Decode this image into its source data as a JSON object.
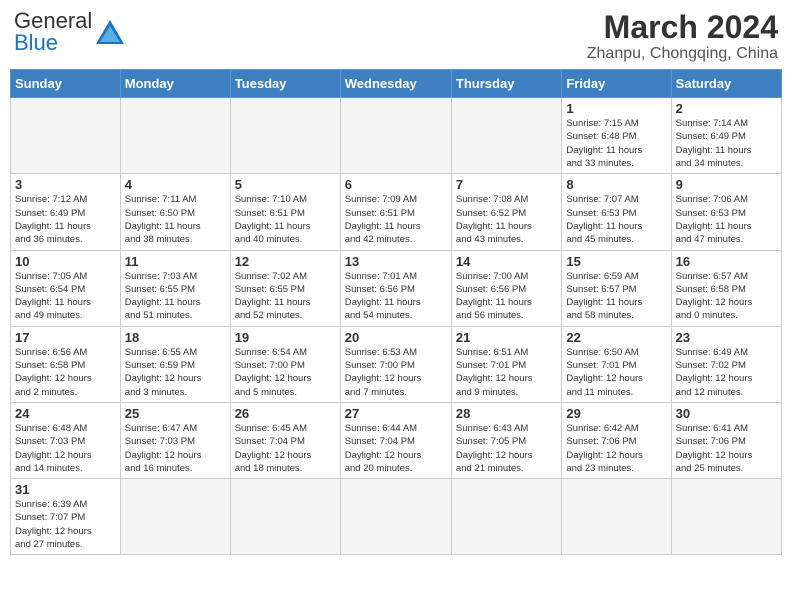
{
  "header": {
    "logo_general": "General",
    "logo_blue": "Blue",
    "month_year": "March 2024",
    "location": "Zhanpu, Chongqing, China"
  },
  "weekdays": [
    "Sunday",
    "Monday",
    "Tuesday",
    "Wednesday",
    "Thursday",
    "Friday",
    "Saturday"
  ],
  "weeks": [
    [
      {
        "day": "",
        "info": ""
      },
      {
        "day": "",
        "info": ""
      },
      {
        "day": "",
        "info": ""
      },
      {
        "day": "",
        "info": ""
      },
      {
        "day": "",
        "info": ""
      },
      {
        "day": "1",
        "info": "Sunrise: 7:15 AM\nSunset: 6:48 PM\nDaylight: 11 hours\nand 33 minutes."
      },
      {
        "day": "2",
        "info": "Sunrise: 7:14 AM\nSunset: 6:49 PM\nDaylight: 11 hours\nand 34 minutes."
      }
    ],
    [
      {
        "day": "3",
        "info": "Sunrise: 7:12 AM\nSunset: 6:49 PM\nDaylight: 11 hours\nand 36 minutes."
      },
      {
        "day": "4",
        "info": "Sunrise: 7:11 AM\nSunset: 6:50 PM\nDaylight: 11 hours\nand 38 minutes."
      },
      {
        "day": "5",
        "info": "Sunrise: 7:10 AM\nSunset: 6:51 PM\nDaylight: 11 hours\nand 40 minutes."
      },
      {
        "day": "6",
        "info": "Sunrise: 7:09 AM\nSunset: 6:51 PM\nDaylight: 11 hours\nand 42 minutes."
      },
      {
        "day": "7",
        "info": "Sunrise: 7:08 AM\nSunset: 6:52 PM\nDaylight: 11 hours\nand 43 minutes."
      },
      {
        "day": "8",
        "info": "Sunrise: 7:07 AM\nSunset: 6:53 PM\nDaylight: 11 hours\nand 45 minutes."
      },
      {
        "day": "9",
        "info": "Sunrise: 7:06 AM\nSunset: 6:53 PM\nDaylight: 11 hours\nand 47 minutes."
      }
    ],
    [
      {
        "day": "10",
        "info": "Sunrise: 7:05 AM\nSunset: 6:54 PM\nDaylight: 11 hours\nand 49 minutes."
      },
      {
        "day": "11",
        "info": "Sunrise: 7:03 AM\nSunset: 6:55 PM\nDaylight: 11 hours\nand 51 minutes."
      },
      {
        "day": "12",
        "info": "Sunrise: 7:02 AM\nSunset: 6:55 PM\nDaylight: 11 hours\nand 52 minutes."
      },
      {
        "day": "13",
        "info": "Sunrise: 7:01 AM\nSunset: 6:56 PM\nDaylight: 11 hours\nand 54 minutes."
      },
      {
        "day": "14",
        "info": "Sunrise: 7:00 AM\nSunset: 6:56 PM\nDaylight: 11 hours\nand 56 minutes."
      },
      {
        "day": "15",
        "info": "Sunrise: 6:59 AM\nSunset: 6:57 PM\nDaylight: 11 hours\nand 58 minutes."
      },
      {
        "day": "16",
        "info": "Sunrise: 6:57 AM\nSunset: 6:58 PM\nDaylight: 12 hours\nand 0 minutes."
      }
    ],
    [
      {
        "day": "17",
        "info": "Sunrise: 6:56 AM\nSunset: 6:58 PM\nDaylight: 12 hours\nand 2 minutes."
      },
      {
        "day": "18",
        "info": "Sunrise: 6:55 AM\nSunset: 6:59 PM\nDaylight: 12 hours\nand 3 minutes."
      },
      {
        "day": "19",
        "info": "Sunrise: 6:54 AM\nSunset: 7:00 PM\nDaylight: 12 hours\nand 5 minutes."
      },
      {
        "day": "20",
        "info": "Sunrise: 6:53 AM\nSunset: 7:00 PM\nDaylight: 12 hours\nand 7 minutes."
      },
      {
        "day": "21",
        "info": "Sunrise: 6:51 AM\nSunset: 7:01 PM\nDaylight: 12 hours\nand 9 minutes."
      },
      {
        "day": "22",
        "info": "Sunrise: 6:50 AM\nSunset: 7:01 PM\nDaylight: 12 hours\nand 11 minutes."
      },
      {
        "day": "23",
        "info": "Sunrise: 6:49 AM\nSunset: 7:02 PM\nDaylight: 12 hours\nand 12 minutes."
      }
    ],
    [
      {
        "day": "24",
        "info": "Sunrise: 6:48 AM\nSunset: 7:03 PM\nDaylight: 12 hours\nand 14 minutes."
      },
      {
        "day": "25",
        "info": "Sunrise: 6:47 AM\nSunset: 7:03 PM\nDaylight: 12 hours\nand 16 minutes."
      },
      {
        "day": "26",
        "info": "Sunrise: 6:45 AM\nSunset: 7:04 PM\nDaylight: 12 hours\nand 18 minutes."
      },
      {
        "day": "27",
        "info": "Sunrise: 6:44 AM\nSunset: 7:04 PM\nDaylight: 12 hours\nand 20 minutes."
      },
      {
        "day": "28",
        "info": "Sunrise: 6:43 AM\nSunset: 7:05 PM\nDaylight: 12 hours\nand 21 minutes."
      },
      {
        "day": "29",
        "info": "Sunrise: 6:42 AM\nSunset: 7:06 PM\nDaylight: 12 hours\nand 23 minutes."
      },
      {
        "day": "30",
        "info": "Sunrise: 6:41 AM\nSunset: 7:06 PM\nDaylight: 12 hours\nand 25 minutes."
      }
    ],
    [
      {
        "day": "31",
        "info": "Sunrise: 6:39 AM\nSunset: 7:07 PM\nDaylight: 12 hours\nand 27 minutes."
      },
      {
        "day": "",
        "info": ""
      },
      {
        "day": "",
        "info": ""
      },
      {
        "day": "",
        "info": ""
      },
      {
        "day": "",
        "info": ""
      },
      {
        "day": "",
        "info": ""
      },
      {
        "day": "",
        "info": ""
      }
    ]
  ]
}
